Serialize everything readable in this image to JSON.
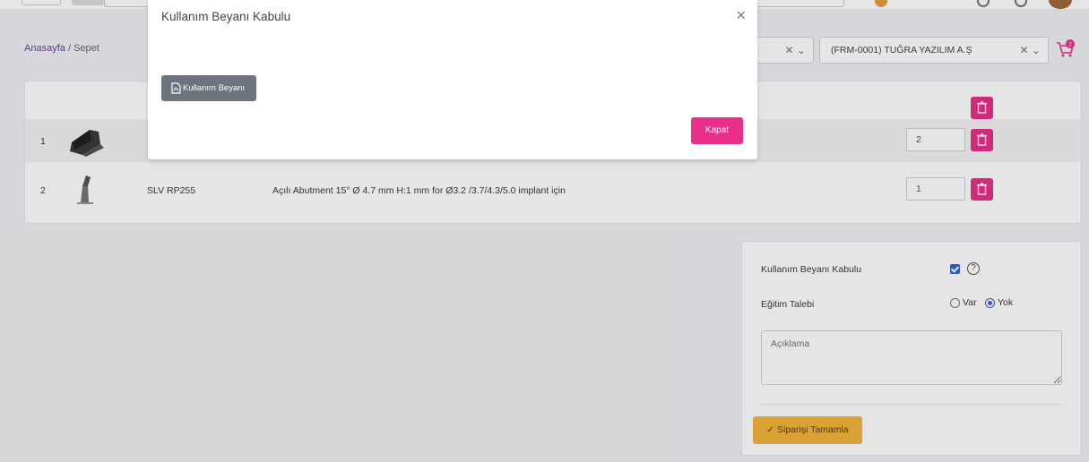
{
  "breadcrumb": {
    "home": "Anasayfa",
    "separator": "/",
    "current": "Sepet"
  },
  "selectors": [
    {
      "value": ""
    },
    {
      "value": "(FRM-0001) TUĞRA YAZILIM A.Ş"
    }
  ],
  "cart": {
    "badge_count": "2",
    "rows": [
      {
        "no": "1",
        "code": "",
        "description": "",
        "quantity": "2"
      },
      {
        "no": "2",
        "code": "SLV RP255",
        "description": "Açılı Abutment 15° Ø 4.7 mm H:1 mm for Ø3.2 /3.7/4.3/5.0 implant için",
        "quantity": "1"
      }
    ]
  },
  "order": {
    "terms_label": "Kullanım Beyanı Kabulu",
    "terms_checked": true,
    "help_symbol": "?",
    "training_label": "Eğitim Talebi",
    "training_options": [
      "Var",
      "Yok"
    ],
    "training_selected": "Yok",
    "note_placeholder": "Açıklama",
    "complete_label": "✓ Siparişi Tamamla"
  },
  "modal": {
    "title": "Kullanım Beyanı Kabulu",
    "close_symbol": "×",
    "document_button": "Kullanım Beyanı",
    "close_button": "Kapat"
  },
  "colors": {
    "accent_pink": "#e8308a",
    "accent_yellow": "#f3b43b",
    "gray_button": "#6c757d",
    "link_purple": "#6a3ea1"
  }
}
